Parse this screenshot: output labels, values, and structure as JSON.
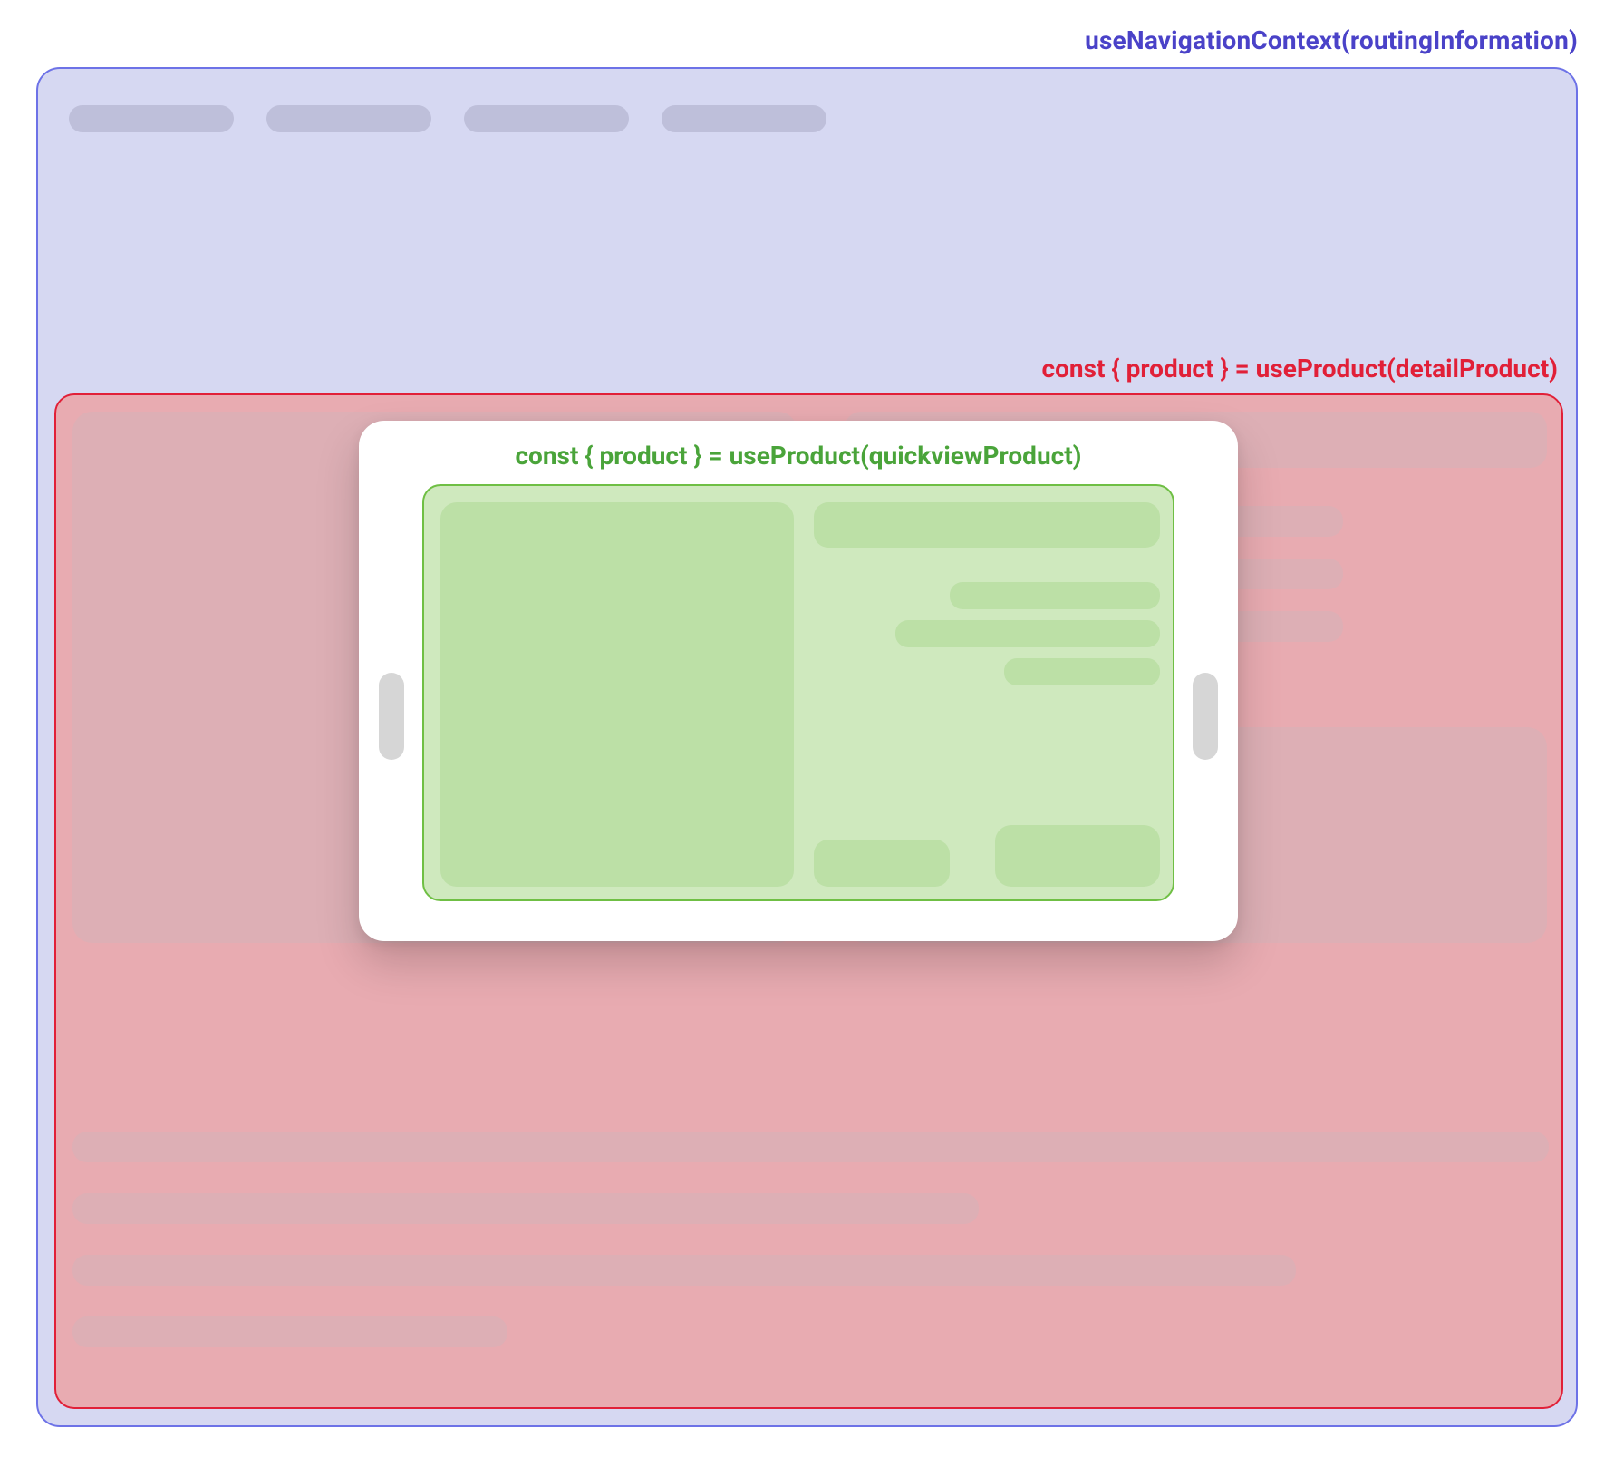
{
  "labels": {
    "outer": "useNavigationContext(routingInformation)",
    "middle": "const { product } = useProduct(detailProduct)",
    "inner": "const { product } = useProduct(quickviewProduct)"
  },
  "colors": {
    "outer_border": "#6d72e7",
    "outer_fill": "#d6d8f2",
    "outer_text": "#4a42c8",
    "middle_border": "#e12038",
    "middle_fill": "#e8abb1",
    "middle_text": "#e12038",
    "inner_border": "#6fbf44",
    "inner_fill": "#cfe9be",
    "inner_text": "#4aa43a"
  }
}
